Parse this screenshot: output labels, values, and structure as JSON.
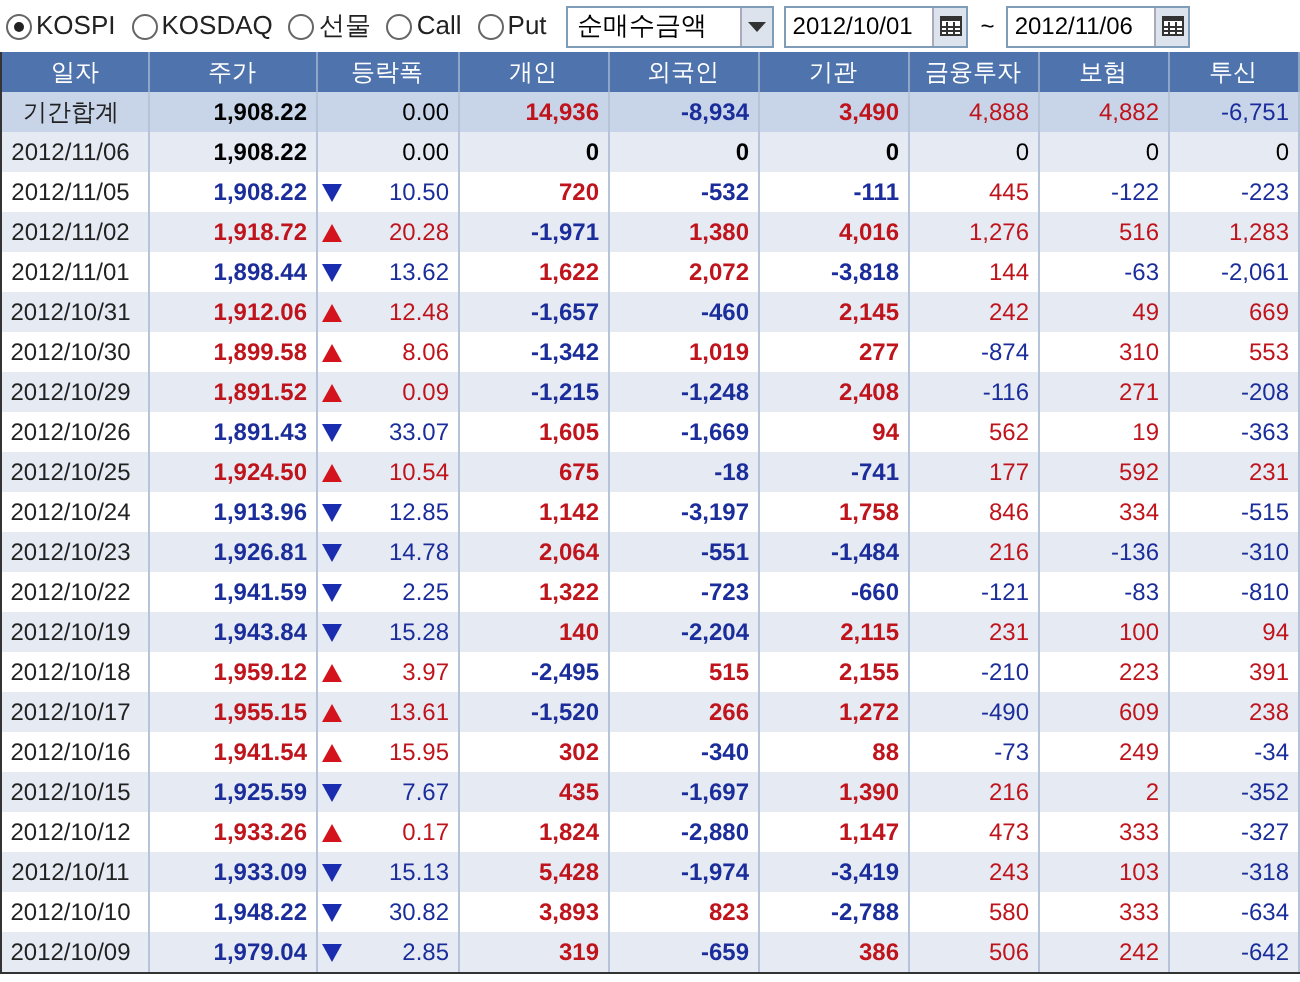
{
  "toolbar": {
    "markets": [
      {
        "label": "KOSPI",
        "selected": true
      },
      {
        "label": "KOSDAQ",
        "selected": false
      },
      {
        "label": "선물",
        "selected": false
      },
      {
        "label": "Call",
        "selected": false
      },
      {
        "label": "Put",
        "selected": false
      }
    ],
    "measure": {
      "value": "순매수금액"
    },
    "date_from": {
      "value": "2012/10/01"
    },
    "range_separator": "~",
    "date_to": {
      "value": "2012/11/06"
    }
  },
  "table": {
    "columns": [
      "일자",
      "주가",
      "등락폭",
      "개인",
      "외국인",
      "기관",
      "금융투자",
      "보험",
      "투신"
    ],
    "rows": [
      {
        "kind": "total",
        "date": "기간합계",
        "price": "1,908.22",
        "rising": false,
        "falling": false,
        "change": "0.00",
        "flows": [
          "14,936",
          "-8,934",
          "3,490",
          "4,888",
          "4,882",
          "-6,751"
        ]
      },
      {
        "kind": "day",
        "date": "2012/11/06",
        "price": "1,908.22",
        "rising": false,
        "falling": false,
        "change": "0.00",
        "flows": [
          "0",
          "0",
          "0",
          "0",
          "0",
          "0"
        ]
      },
      {
        "kind": "day",
        "date": "2012/11/05",
        "price": "1,908.22",
        "rising": false,
        "falling": true,
        "change": "10.50",
        "flows": [
          "720",
          "-532",
          "-111",
          "445",
          "-122",
          "-223"
        ]
      },
      {
        "kind": "day",
        "date": "2012/11/02",
        "price": "1,918.72",
        "rising": true,
        "falling": false,
        "change": "20.28",
        "flows": [
          "-1,971",
          "1,380",
          "4,016",
          "1,276",
          "516",
          "1,283"
        ]
      },
      {
        "kind": "day",
        "date": "2012/11/01",
        "price": "1,898.44",
        "rising": false,
        "falling": true,
        "change": "13.62",
        "flows": [
          "1,622",
          "2,072",
          "-3,818",
          "144",
          "-63",
          "-2,061"
        ]
      },
      {
        "kind": "day",
        "date": "2012/10/31",
        "price": "1,912.06",
        "rising": true,
        "falling": false,
        "change": "12.48",
        "flows": [
          "-1,657",
          "-460",
          "2,145",
          "242",
          "49",
          "669"
        ]
      },
      {
        "kind": "day",
        "date": "2012/10/30",
        "price": "1,899.58",
        "rising": true,
        "falling": false,
        "change": "8.06",
        "flows": [
          "-1,342",
          "1,019",
          "277",
          "-874",
          "310",
          "553"
        ]
      },
      {
        "kind": "day",
        "date": "2012/10/29",
        "price": "1,891.52",
        "rising": true,
        "falling": false,
        "change": "0.09",
        "flows": [
          "-1,215",
          "-1,248",
          "2,408",
          "-116",
          "271",
          "-208"
        ]
      },
      {
        "kind": "day",
        "date": "2012/10/26",
        "price": "1,891.43",
        "rising": false,
        "falling": true,
        "change": "33.07",
        "flows": [
          "1,605",
          "-1,669",
          "94",
          "562",
          "19",
          "-363"
        ]
      },
      {
        "kind": "day",
        "date": "2012/10/25",
        "price": "1,924.50",
        "rising": true,
        "falling": false,
        "change": "10.54",
        "flows": [
          "675",
          "-18",
          "-741",
          "177",
          "592",
          "231"
        ]
      },
      {
        "kind": "day",
        "date": "2012/10/24",
        "price": "1,913.96",
        "rising": false,
        "falling": true,
        "change": "12.85",
        "flows": [
          "1,142",
          "-3,197",
          "1,758",
          "846",
          "334",
          "-515"
        ]
      },
      {
        "kind": "day",
        "date": "2012/10/23",
        "price": "1,926.81",
        "rising": false,
        "falling": true,
        "change": "14.78",
        "flows": [
          "2,064",
          "-551",
          "-1,484",
          "216",
          "-136",
          "-310"
        ]
      },
      {
        "kind": "day",
        "date": "2012/10/22",
        "price": "1,941.59",
        "rising": false,
        "falling": true,
        "change": "2.25",
        "flows": [
          "1,322",
          "-723",
          "-660",
          "-121",
          "-83",
          "-810"
        ]
      },
      {
        "kind": "day",
        "date": "2012/10/19",
        "price": "1,943.84",
        "rising": false,
        "falling": true,
        "change": "15.28",
        "flows": [
          "140",
          "-2,204",
          "2,115",
          "231",
          "100",
          "94"
        ]
      },
      {
        "kind": "day",
        "date": "2012/10/18",
        "price": "1,959.12",
        "rising": true,
        "falling": false,
        "change": "3.97",
        "flows": [
          "-2,495",
          "515",
          "2,155",
          "-210",
          "223",
          "391"
        ]
      },
      {
        "kind": "day",
        "date": "2012/10/17",
        "price": "1,955.15",
        "rising": true,
        "falling": false,
        "change": "13.61",
        "flows": [
          "-1,520",
          "266",
          "1,272",
          "-490",
          "609",
          "238"
        ]
      },
      {
        "kind": "day",
        "date": "2012/10/16",
        "price": "1,941.54",
        "rising": true,
        "falling": false,
        "change": "15.95",
        "flows": [
          "302",
          "-340",
          "88",
          "-73",
          "249",
          "-34"
        ]
      },
      {
        "kind": "day",
        "date": "2012/10/15",
        "price": "1,925.59",
        "rising": false,
        "falling": true,
        "change": "7.67",
        "flows": [
          "435",
          "-1,697",
          "1,390",
          "216",
          "2",
          "-352"
        ]
      },
      {
        "kind": "day",
        "date": "2012/10/12",
        "price": "1,933.26",
        "rising": true,
        "falling": false,
        "change": "0.17",
        "flows": [
          "1,824",
          "-2,880",
          "1,147",
          "473",
          "333",
          "-327"
        ]
      },
      {
        "kind": "day",
        "date": "2012/10/11",
        "price": "1,933.09",
        "rising": false,
        "falling": true,
        "change": "15.13",
        "flows": [
          "5,428",
          "-1,974",
          "-3,419",
          "243",
          "103",
          "-318"
        ]
      },
      {
        "kind": "day",
        "date": "2012/10/10",
        "price": "1,948.22",
        "rising": false,
        "falling": true,
        "change": "30.82",
        "flows": [
          "3,893",
          "823",
          "-2,788",
          "580",
          "333",
          "-634"
        ]
      },
      {
        "kind": "day",
        "date": "2012/10/09",
        "price": "1,979.04",
        "rising": false,
        "falling": true,
        "change": "2.85",
        "flows": [
          "319",
          "-659",
          "386",
          "506",
          "242",
          "-642"
        ]
      }
    ]
  }
}
